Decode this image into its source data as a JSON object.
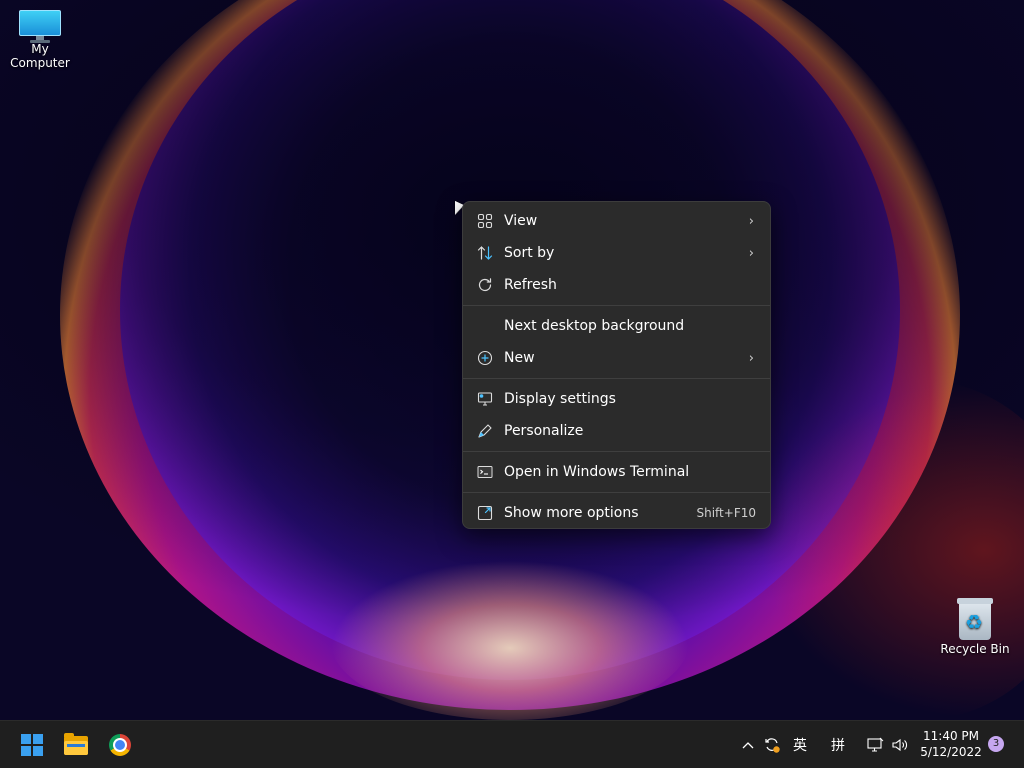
{
  "desktop": {
    "icons": [
      {
        "label": "My Computer",
        "icon": "monitor-icon"
      },
      {
        "label": "Recycle Bin",
        "icon": "recycle-bin-icon"
      }
    ]
  },
  "context_menu": {
    "groups": [
      [
        {
          "label": "View",
          "icon": "view-grid-icon",
          "submenu": true
        },
        {
          "label": "Sort by",
          "icon": "sort-icon",
          "submenu": true
        },
        {
          "label": "Refresh",
          "icon": "refresh-icon",
          "submenu": false
        }
      ],
      [
        {
          "label": "Next desktop background",
          "icon": "",
          "submenu": false
        },
        {
          "label": "New",
          "icon": "add-circle-icon",
          "submenu": true
        }
      ],
      [
        {
          "label": "Display settings",
          "icon": "display-icon",
          "submenu": false
        },
        {
          "label": "Personalize",
          "icon": "pen-icon",
          "submenu": false
        }
      ],
      [
        {
          "label": "Open in Windows Terminal",
          "icon": "terminal-icon",
          "submenu": false
        }
      ],
      [
        {
          "label": "Show more options",
          "icon": "expand-icon",
          "submenu": false,
          "shortcut": "Shift+F10"
        }
      ]
    ],
    "arrow_glyph": "›"
  },
  "taskbar": {
    "apps": [
      {
        "name": "Start",
        "icon": "windows-start-icon"
      },
      {
        "name": "File Explorer",
        "icon": "file-explorer-icon"
      },
      {
        "name": "Google Chrome",
        "icon": "chrome-icon"
      }
    ],
    "tray": {
      "chevron": "^",
      "ime_lang": "英",
      "ime_mode": "拼",
      "time": "11:40 PM",
      "date": "5/12/2022",
      "notification_count": "3"
    }
  },
  "colors": {
    "accent": "#3aa0f0",
    "menu_bg": "#2b2b2b",
    "taskbar_bg": "#1f1f1f"
  }
}
